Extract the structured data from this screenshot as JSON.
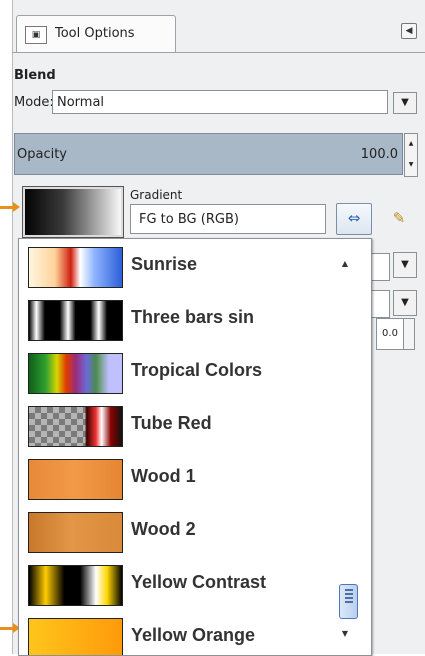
{
  "header": {
    "tab_label": "Tool Options",
    "tab_icon": "tool-options-icon",
    "menu_icon": "tab-menu-icon"
  },
  "blend": {
    "section": "Blend",
    "mode_label": "Mode:",
    "mode_value": "Normal",
    "opacity_label": "Opacity",
    "opacity_value": "100.0",
    "gradient_label": "Gradient",
    "gradient_name": "FG to BG (RGB)",
    "offset_value": "0.0"
  },
  "gradient_list": [
    {
      "label": "Sunrise",
      "swatch": "sunrise"
    },
    {
      "label": "Three bars sin",
      "swatch": "three-bars"
    },
    {
      "label": "Tropical Colors",
      "swatch": "tropical"
    },
    {
      "label": "Tube Red",
      "swatch": "tube-red"
    },
    {
      "label": "Wood 1",
      "swatch": "wood1"
    },
    {
      "label": "Wood 2",
      "swatch": "wood2"
    },
    {
      "label": "Yellow Contrast",
      "swatch": "yellow-contrast"
    },
    {
      "label": "Yellow Orange",
      "swatch": "yellow-orange"
    }
  ],
  "colors": {
    "accent": "#e8901a",
    "opacity_fill": "#a8b8c6",
    "panel": "#eef0f2"
  }
}
